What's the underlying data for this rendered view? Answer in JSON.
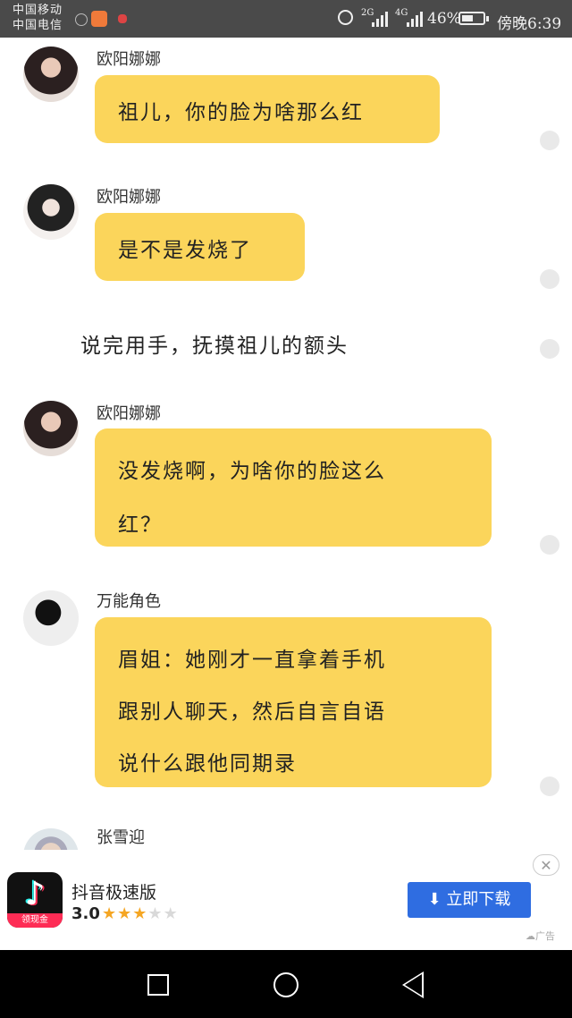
{
  "status_bar": {
    "carrier_1": "中国移动",
    "carrier_2": "中国电信",
    "net_1": "2G",
    "net_2": "4G",
    "battery": "46%",
    "time": "傍晚6:39"
  },
  "messages": [
    {
      "sender": "欧阳娜娜",
      "lines": [
        "祖儿，你的脸为啥那么红"
      ]
    },
    {
      "sender": "欧阳娜娜",
      "lines": [
        "是不是发烧了"
      ]
    },
    {
      "narration": "说完用手，抚摸祖儿的额头"
    },
    {
      "sender": "欧阳娜娜",
      "lines": [
        "没发烧啊，为啥你的脸这么",
        "红？"
      ]
    },
    {
      "sender": "万能角色",
      "lines": [
        "眉姐：她刚才一直拿着手机",
        "跟别人聊天，然后自言自语",
        "说什么跟他同期录"
      ]
    },
    {
      "sender": "张雪迎"
    }
  ],
  "ad": {
    "app_name": "抖音极速版",
    "rating": "3.0",
    "stars_filled": 3,
    "stars_total": 5,
    "badge": "领现金",
    "download_label": "立即下载",
    "ad_label": "广告",
    "brand_colors": {
      "button": "#2f6de1",
      "star": "#f5a623"
    }
  },
  "theme": {
    "bubble_color": "#fbd55b"
  }
}
